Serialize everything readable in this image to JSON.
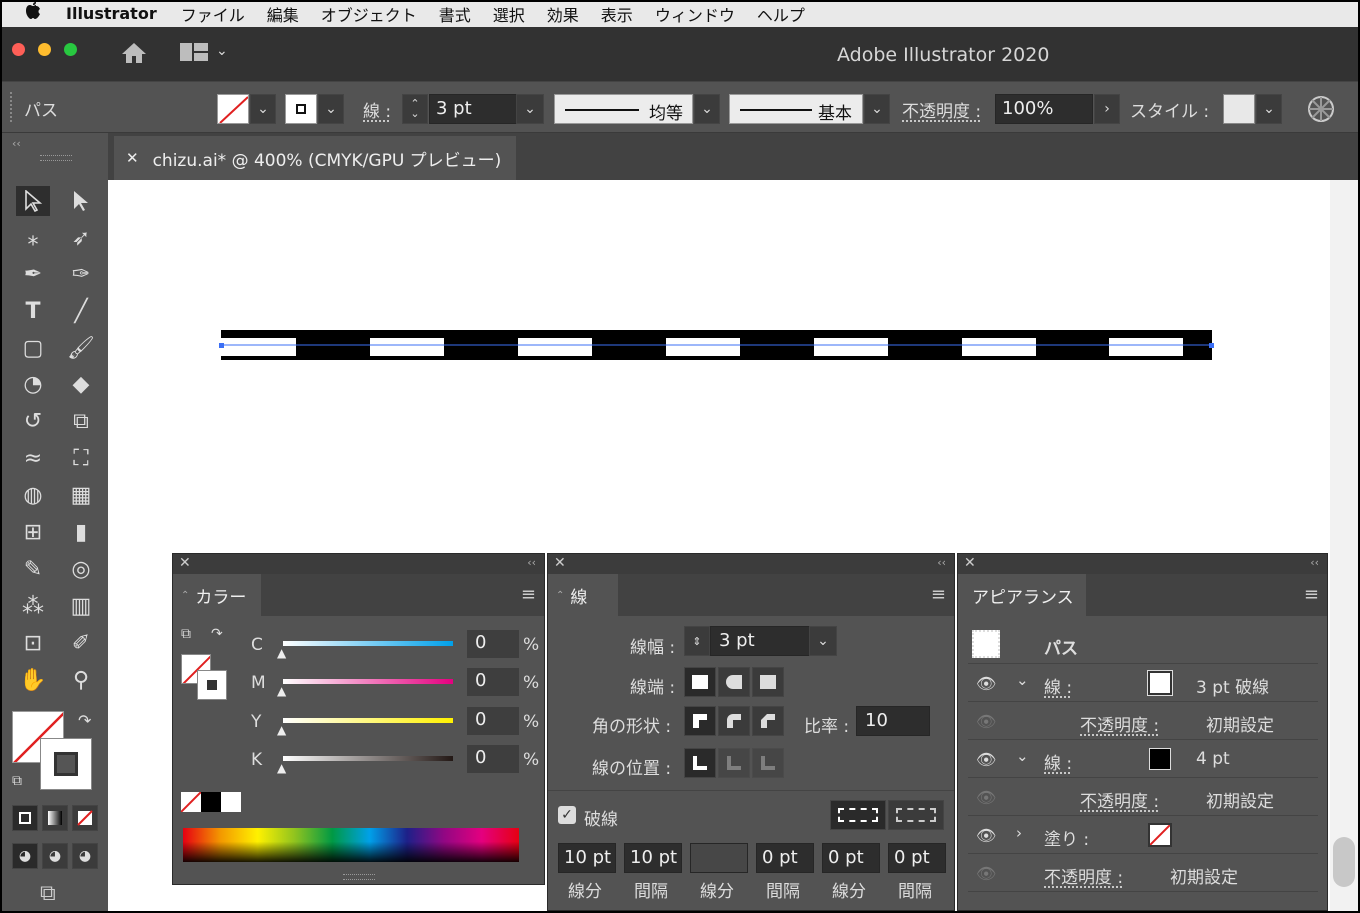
{
  "menubar": {
    "apple": "",
    "app": "Illustrator",
    "items": [
      "ファイル",
      "編集",
      "オブジェクト",
      "書式",
      "選択",
      "効果",
      "表示",
      "ウィンドウ",
      "ヘルプ"
    ]
  },
  "window": {
    "title": "Adobe Illustrator 2020"
  },
  "control": {
    "selection_label": "パス",
    "stroke_label": "線 :",
    "stroke_weight": "3 pt",
    "profile1": "均等",
    "profile2": "基本",
    "opacity_label": "不透明度 :",
    "opacity_value": "100%",
    "style_label": "スタイル :"
  },
  "document": {
    "tab_title": "chizu.ai* @ 400% (CMYK/GPU プレビュー)"
  },
  "color_panel": {
    "title": "カラー",
    "channels": [
      {
        "label": "C",
        "value": "0",
        "unit": "%"
      },
      {
        "label": "M",
        "value": "0",
        "unit": "%"
      },
      {
        "label": "Y",
        "value": "0",
        "unit": "%"
      },
      {
        "label": "K",
        "value": "0",
        "unit": "%"
      }
    ]
  },
  "stroke_panel": {
    "title": "線",
    "weight_label": "線幅 :",
    "weight_value": "3 pt",
    "cap_label": "線端 :",
    "corner_label": "角の形状 :",
    "limit_label": "比率 :",
    "limit_value": "10",
    "align_label": "線の位置 :",
    "dashed_label": "破線",
    "dashed_checked": true,
    "dash_values": [
      "10 pt",
      "10 pt",
      "",
      "0 pt",
      "0 pt",
      "0 pt"
    ],
    "dash_labels": [
      "線分",
      "間隔",
      "線分",
      "間隔",
      "線分",
      "間隔"
    ]
  },
  "appearance_panel": {
    "title": "アピアランス",
    "object": "パス",
    "rows": [
      {
        "label": "線 :",
        "value": "3 pt 破線"
      },
      {
        "label": "不透明度 :",
        "value": "初期設定"
      },
      {
        "label": "線 :",
        "value": "4 pt"
      },
      {
        "label": "不透明度 :",
        "value": "初期設定"
      },
      {
        "label": "塗り :",
        "value": ""
      },
      {
        "label": "不透明度 :",
        "value": "初期設定"
      }
    ]
  },
  "colors": {
    "accent": "#3b6ff5",
    "panel": "#535353",
    "dark": "#323232"
  }
}
